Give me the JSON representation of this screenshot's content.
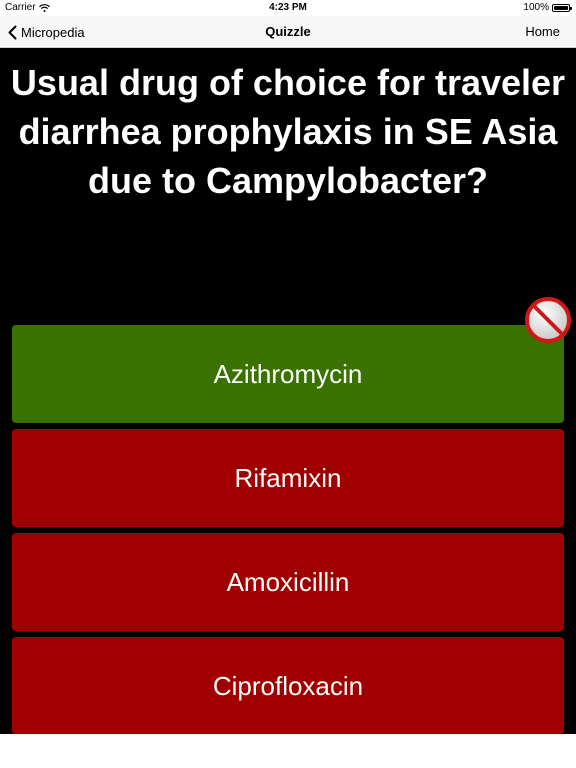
{
  "status_bar": {
    "carrier": "Carrier",
    "time": "4:23 PM",
    "battery": "100%"
  },
  "nav": {
    "back_label": "Micropedia",
    "title": "Quizzle",
    "home_label": "Home"
  },
  "question": "Usual drug of choice for traveler diarrhea prophylaxis in SE Asia due to Campylobacter?",
  "answers": [
    {
      "label": "Azithromycin",
      "state": "correct",
      "color": "#3a7200"
    },
    {
      "label": "Rifamixin",
      "state": "wrong",
      "color": "#a10000"
    },
    {
      "label": "Amoxicillin",
      "state": "wrong",
      "color": "#a10000"
    },
    {
      "label": "Ciprofloxacin",
      "state": "wrong",
      "color": "#a10000"
    }
  ],
  "icons": {
    "back": "chevron-left-icon",
    "wifi": "wifi-icon",
    "battery": "battery-icon",
    "no_entry": "no-entry-icon"
  }
}
